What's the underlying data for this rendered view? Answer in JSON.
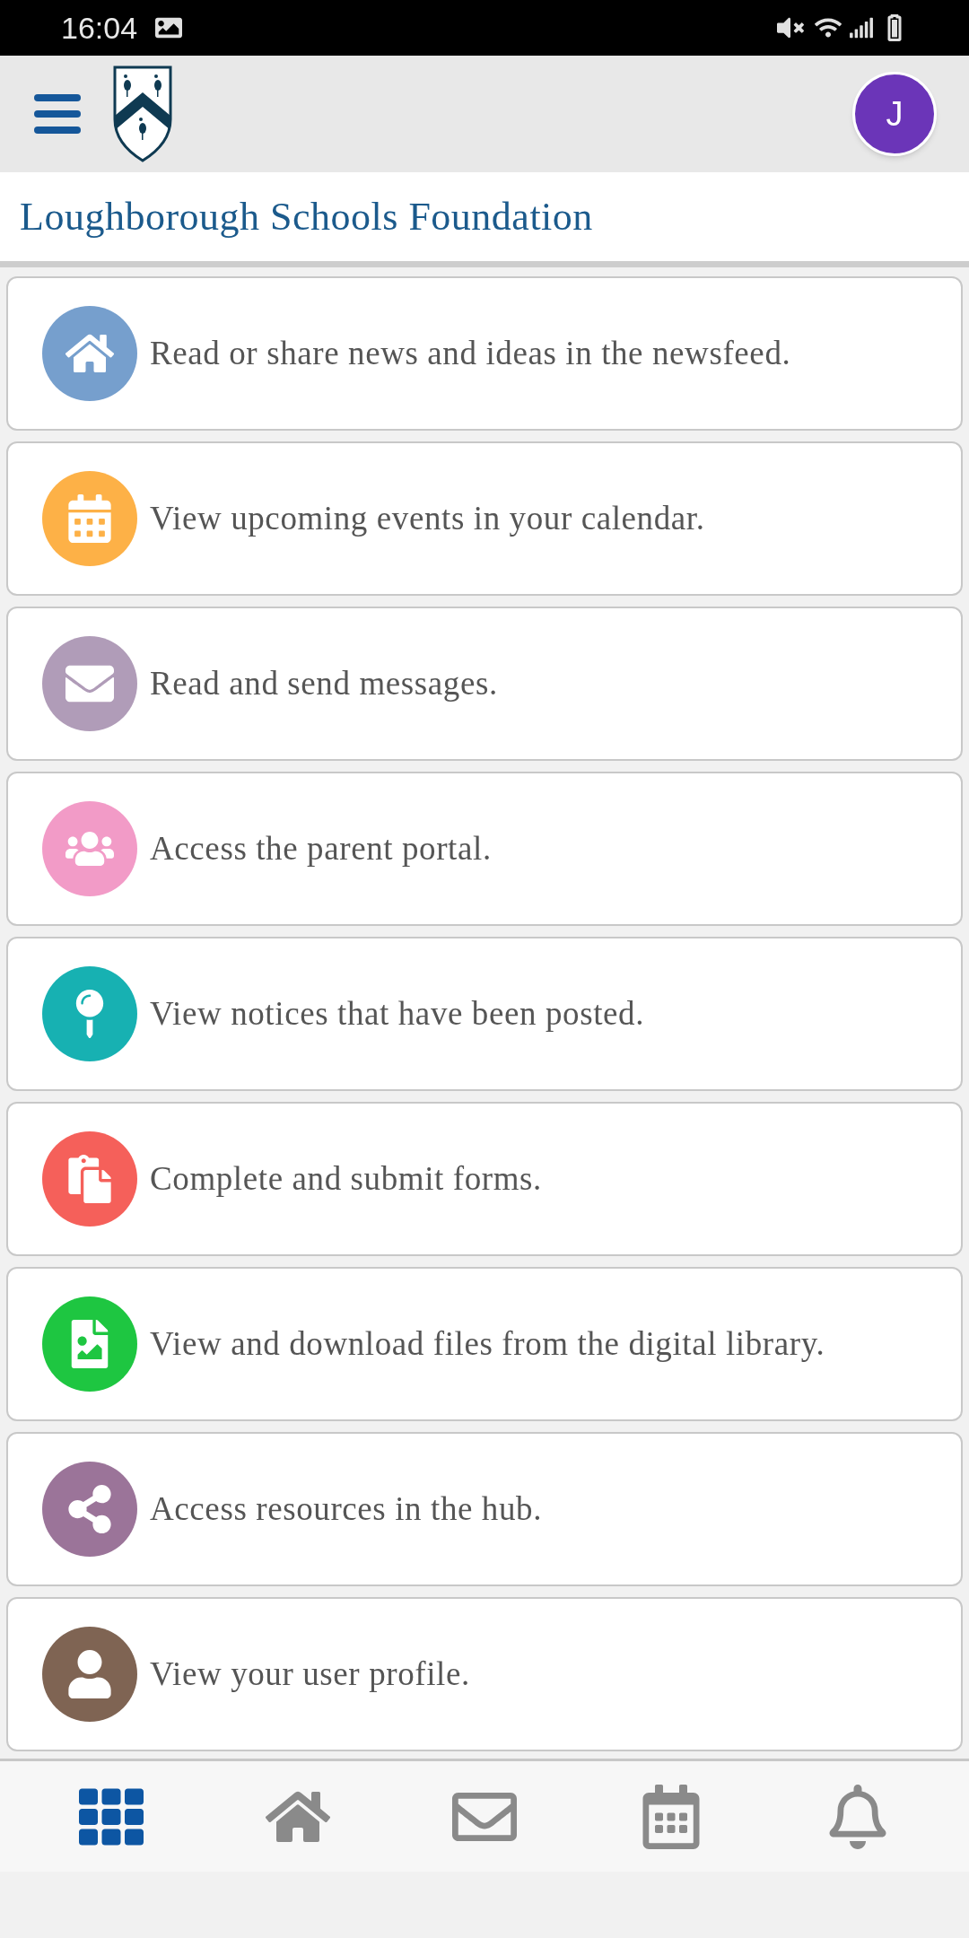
{
  "status_bar": {
    "time": "16:04"
  },
  "header": {
    "avatar_letter": "J"
  },
  "title": "Loughborough Schools Foundation",
  "items": [
    {
      "text": "Read or share news and ideas in the newsfeed.",
      "color": "#769fcd"
    },
    {
      "text": "View upcoming events in your calendar.",
      "color": "#fdb147"
    },
    {
      "text": "Read and send messages.",
      "color": "#b09cb8"
    },
    {
      "text": "Access the parent portal.",
      "color": "#f29bc7"
    },
    {
      "text": "View notices that have been posted.",
      "color": "#17b1b2"
    },
    {
      "text": "Complete and submit forms.",
      "color": "#f5605a"
    },
    {
      "text": "View and download files from the digital library.",
      "color": "#1ec641"
    },
    {
      "text": "Access resources in the hub.",
      "color": "#9b7499"
    },
    {
      "text": "View your user profile.",
      "color": "#7f6453"
    }
  ],
  "bottom_nav": [
    {
      "selected": true
    },
    {
      "selected": false
    },
    {
      "selected": false
    },
    {
      "selected": false
    },
    {
      "selected": false
    }
  ]
}
